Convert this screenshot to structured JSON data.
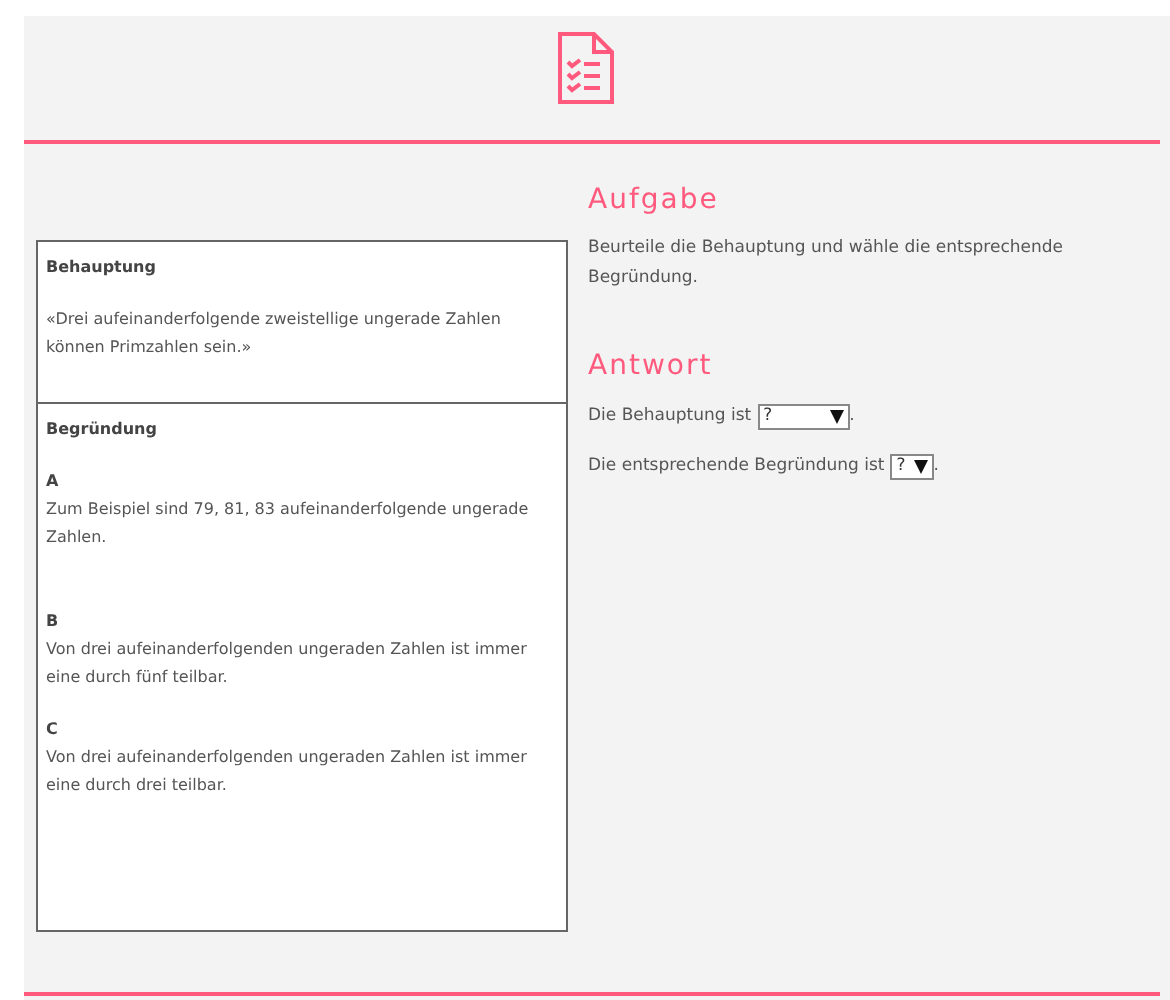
{
  "left_panel": {
    "claim": {
      "heading": "Behauptung",
      "text": "«Drei aufeinanderfolgende zweistellige ungerade Zahlen können Primzahlen sein.»"
    },
    "reasons": {
      "heading": "Begründung",
      "options": [
        {
          "letter": "A",
          "text": "Zum Beispiel sind 79, 81, 83 aufeinanderfolgende ungerade Zahlen."
        },
        {
          "letter": "B",
          "text": "Von drei aufeinanderfolgenden ungeraden Zahlen ist immer eine durch fünf teilbar."
        },
        {
          "letter": "C",
          "text": "Von drei aufeinanderfolgenden ungeraden Zahlen ist immer eine durch drei teilbar."
        }
      ]
    }
  },
  "task": {
    "heading": "Aufgabe",
    "text": "Beurteile die Behauptung und wähle die entsprechende Begründung."
  },
  "answer": {
    "heading": "Antwort",
    "fields": [
      {
        "label": "Die Behauptung ist",
        "value": "?",
        "suffix": ".",
        "wide": true
      },
      {
        "label": "Die entsprechende Begründung ist",
        "value": "?",
        "suffix": ".",
        "wide": false
      }
    ]
  }
}
